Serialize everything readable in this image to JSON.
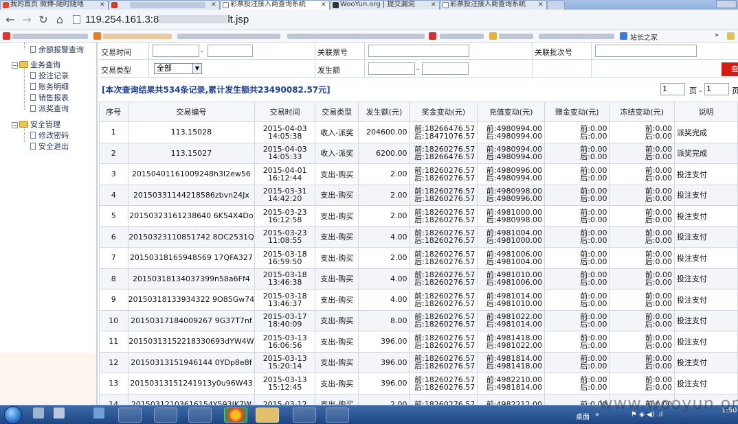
{
  "browser": {
    "tabs": [
      {
        "label": "我的首页 微博-随时随地"
      },
      {
        "label": ""
      },
      {
        "label": "彩票投注接入商查询系统"
      },
      {
        "label": "WooYun.org | 提交漏洞"
      },
      {
        "label": "彩票投注接入商查询系统"
      }
    ],
    "url": "119.254.161.3:8",
    "url_tail": "lt.jsp",
    "bookmark_label": "站长之家",
    "bookmark_more": "»"
  },
  "sidebar": {
    "top_item": "余额报警查询",
    "groups": [
      {
        "label": "业务查询",
        "items": [
          "投注记录",
          "账务明细",
          "销售报表",
          "派奖查询"
        ]
      },
      {
        "label": "安全管理",
        "items": [
          "修改密码",
          "安全退出"
        ]
      }
    ]
  },
  "filters": {
    "trade_time_label": "交易时间",
    "dash": "-",
    "ticket_label": "关联票号",
    "batch_label": "关联批次号",
    "trade_type_label": "交易类型",
    "trade_type_value": "全部",
    "amount_label": "发生额",
    "query_button": "查"
  },
  "summary": "[本次查询结果共534条记录,累计发生额共23490082.57元]",
  "pager": {
    "page": "1",
    "page_sep": "页 -",
    "page_to": "1",
    "page_unit": "页"
  },
  "table": {
    "columns": [
      "序号",
      "交易编号",
      "交易时间",
      "交易类型",
      "发生额(元)",
      "奖金变动(元)",
      "充值变动(元)",
      "赠金变动(元)",
      "冻结变动(元)",
      "说明"
    ],
    "rows": [
      {
        "no": "1",
        "id": "113.15028",
        "date": "2015-04-03",
        "time": "14:05:38",
        "type": "收入-派奖",
        "amount": "204600.00",
        "prize_before": "前:18266476.57",
        "prize_after": "后:18471076.57",
        "charge_before": "前:4980994.00",
        "charge_after": "后:4980994.00",
        "gift_before": "前:0.00",
        "gift_after": "后:0.00",
        "frozen_before": "前:0.00",
        "frozen_after": "后:0.00",
        "note": "派奖完成"
      },
      {
        "no": "2",
        "id": "113.15027",
        "date": "2015-04-03",
        "time": "14:05:33",
        "type": "收入-派奖",
        "amount": "6200.00",
        "prize_before": "前:18260276.57",
        "prize_after": "后:18266476.57",
        "charge_before": "前:4980994.00",
        "charge_after": "后:4980994.00",
        "gift_before": "前:0.00",
        "gift_after": "后:0.00",
        "frozen_before": "前:0.00",
        "frozen_after": "后:0.00",
        "note": "派奖完成"
      },
      {
        "no": "3",
        "id": "20150401161009248h3I2ew56",
        "date": "2015-04-01",
        "time": "16:12:44",
        "type": "支出-购买",
        "amount": "2.00",
        "prize_before": "前:18260276.57",
        "prize_after": "后:18260276.57",
        "charge_before": "前:4980996.00",
        "charge_after": "后:4980994.00",
        "gift_before": "前:0.00",
        "gift_after": "后:0.00",
        "frozen_before": "前:0.00",
        "frozen_after": "后:0.00",
        "note": "投注支付"
      },
      {
        "no": "4",
        "id": "20150331144218586zbvn24Jx",
        "date": "2015-03-31",
        "time": "14:42:20",
        "type": "支出-购买",
        "amount": "2.00",
        "prize_before": "前:18260276.57",
        "prize_after": "后:18260276.57",
        "charge_before": "前:4980998.00",
        "charge_after": "后:4980996.00",
        "gift_before": "前:0.00",
        "gift_after": "后:0.00",
        "frozen_before": "前:0.00",
        "frozen_after": "后:0.00",
        "note": "投注支付"
      },
      {
        "no": "5",
        "id": "20150323161238640 6K54X4Do",
        "date": "2015-03-23",
        "time": "16:12:58",
        "type": "支出-购买",
        "amount": "2.00",
        "prize_before": "前:18260276.57",
        "prize_after": "后:18260276.57",
        "charge_before": "前:4981000.00",
        "charge_after": "后:4980998.00",
        "gift_before": "前:0.00",
        "gift_after": "后:0.00",
        "frozen_before": "前:0.00",
        "frozen_after": "后:0.00",
        "note": "投注支付"
      },
      {
        "no": "6",
        "id": "20150323110851742 8OC2531Q",
        "date": "2015-03-23",
        "time": "11:08:55",
        "type": "支出-购买",
        "amount": "4.00",
        "prize_before": "前:18260276.57",
        "prize_after": "后:18260276.57",
        "charge_before": "前:4981004.00",
        "charge_after": "后:4981000.00",
        "gift_before": "前:0.00",
        "gift_after": "后:0.00",
        "frozen_before": "前:0.00",
        "frozen_after": "后:0.00",
        "note": "投注支付"
      },
      {
        "no": "7",
        "id": "20150318165948569 17QFA327",
        "date": "2015-03-18",
        "time": "16:59:50",
        "type": "支出-购买",
        "amount": "2.00",
        "prize_before": "前:18260276.57",
        "prize_after": "后:18260276.57",
        "charge_before": "前:4981006.00",
        "charge_after": "后:4981004.00",
        "gift_before": "前:0.00",
        "gift_after": "后:0.00",
        "frozen_before": "前:0.00",
        "frozen_after": "后:0.00",
        "note": "投注支付"
      },
      {
        "no": "8",
        "id": "20150318134037399n58a6Ff4",
        "date": "2015-03-18",
        "time": "13:46:38",
        "type": "支出-购买",
        "amount": "4.00",
        "prize_before": "前:18260276.57",
        "prize_after": "后:18260276.57",
        "charge_before": "前:4981010.00",
        "charge_after": "后:4981006.00",
        "gift_before": "前:0.00",
        "gift_after": "后:0.00",
        "frozen_before": "前:0.00",
        "frozen_after": "后:0.00",
        "note": "投注支付"
      },
      {
        "no": "9",
        "id": "20150318133934322 9O85Gw74",
        "date": "2015-03-18",
        "time": "13:46:37",
        "type": "支出-购买",
        "amount": "4.00",
        "prize_before": "前:18260276.57",
        "prize_after": "后:18260276.57",
        "charge_before": "前:4981014.00",
        "charge_after": "后:4981010.00",
        "gift_before": "前:0.00",
        "gift_after": "后:0.00",
        "frozen_before": "前:0.00",
        "frozen_after": "后:0.00",
        "note": "投注支付"
      },
      {
        "no": "10",
        "id": "20150317184009267 9G37T7nf",
        "date": "2015-03-17",
        "time": "18:40:09",
        "type": "支出-购买",
        "amount": "8.00",
        "prize_before": "前:18260276.57",
        "prize_after": "后:18260276.57",
        "charge_before": "前:4981022.00",
        "charge_after": "后:4981014.00",
        "gift_before": "前:0.00",
        "gift_after": "后:0.00",
        "frozen_before": "前:0.00",
        "frozen_after": "后:0.00",
        "note": "投注支付"
      },
      {
        "no": "11",
        "id": "20150313152218330693dYW4W",
        "date": "2015-03-13",
        "time": "16:06:56",
        "type": "支出-购买",
        "amount": "396.00",
        "prize_before": "前:18260276.57",
        "prize_after": "后:18260276.57",
        "charge_before": "前:4981418.00",
        "charge_after": "后:4981022.00",
        "gift_before": "前:0.00",
        "gift_after": "后:0.00",
        "frozen_before": "前:0.00",
        "frozen_after": "后:0.00",
        "note": "投注支付"
      },
      {
        "no": "12",
        "id": "20150313151946144 0YDp8e8f",
        "date": "2015-03-13",
        "time": "15:20:14",
        "type": "支出-购买",
        "amount": "396.00",
        "prize_before": "前:18260276.57",
        "prize_after": "后:18260276.57",
        "charge_before": "前:4981814.00",
        "charge_after": "后:4981418.00",
        "gift_before": "前:0.00",
        "gift_after": "后:0.00",
        "frozen_before": "前:0.00",
        "frozen_after": "后:0.00",
        "note": "投注支付"
      },
      {
        "no": "13",
        "id": "20150313151241913y0u96W43",
        "date": "2015-03-13",
        "time": "15:12:45",
        "type": "支出-购买",
        "amount": "396.00",
        "prize_before": "前:18260276.57",
        "prize_after": "后:18260276.57",
        "charge_before": "前:4982210.00",
        "charge_after": "后:4981814.00",
        "gift_before": "前:0.00",
        "gift_after": "后:0.00",
        "frozen_before": "前:0.00",
        "frozen_after": "后:0.00",
        "note": "投注支付"
      },
      {
        "no": "14",
        "id": "20150312103616154Y593IK7W",
        "date": "2015-03-12",
        "time": "",
        "type": "支出-购买",
        "amount": "2.00",
        "prize_before": "前:18260276.57",
        "prize_after": "",
        "charge_before": "前:4982212.00",
        "charge_after": "",
        "gift_before": "前:0.00",
        "gift_after": "",
        "frozen_before": "前:0.00",
        "frozen_after": "",
        "note": ""
      }
    ]
  },
  "taskbar": {
    "desktop_label": "桌面",
    "time": "1:50",
    "chevron": "»"
  },
  "watermark": "www.wooyun.org",
  "colors": {
    "summary_text": "#1d3f9c",
    "query_button": "#d61a12",
    "taskbar": "#1d4583"
  }
}
